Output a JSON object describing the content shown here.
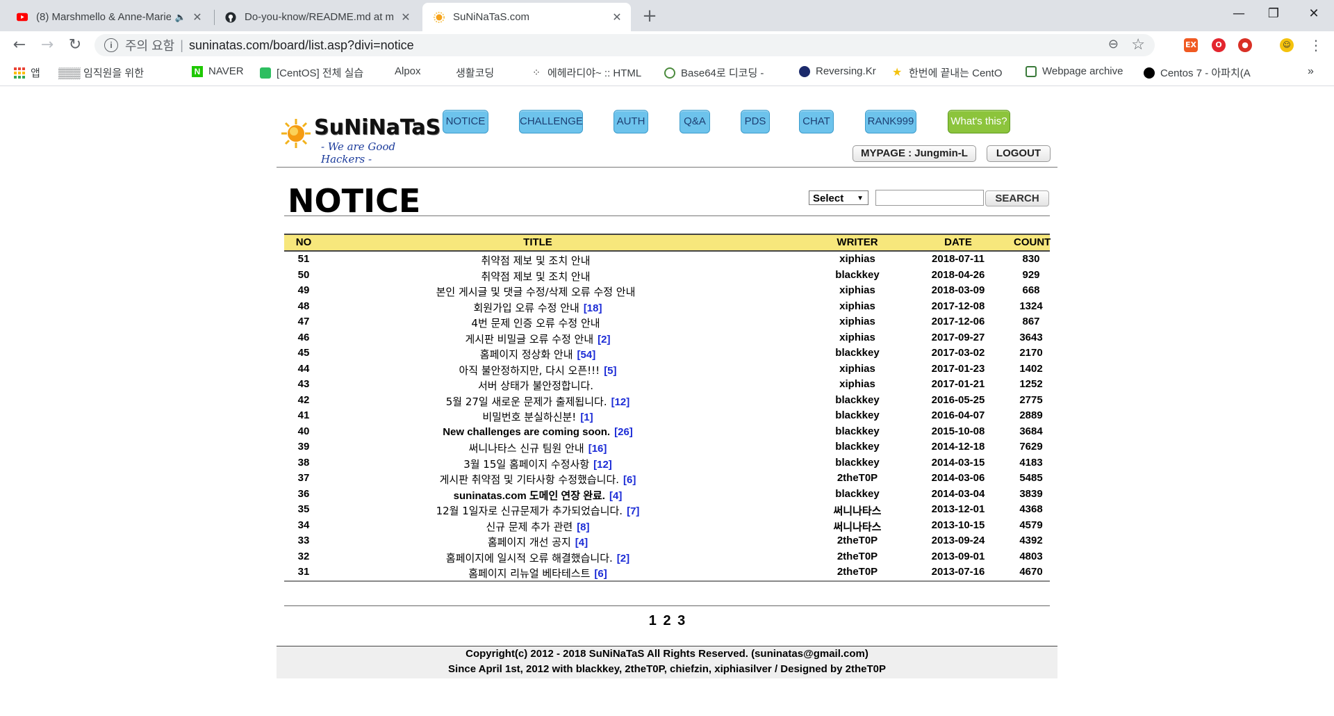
{
  "browser": {
    "tabs": [
      {
        "title": "(8) Marshmello & Anne-Marie",
        "icon": "youtube-icon"
      },
      {
        "title": "Do-you-know/README.md at m",
        "icon": "github-icon"
      },
      {
        "title": "SuNiNaTaS.com",
        "icon": "sun-icon"
      }
    ],
    "address": {
      "warning": "주의 요함",
      "url": "suninatas.com/board/list.asp?divi=notice"
    },
    "bookmarks": [
      {
        "label": "앱",
        "icon": "apps-icon"
      },
      {
        "label": "▒▒▒ 임직원을 위한",
        "icon": "page-icon"
      },
      {
        "label": "NAVER",
        "icon": "naver-icon"
      },
      {
        "label": "[CentOS] 전체 실습",
        "icon": "evernote-icon"
      },
      {
        "label": "Alpox",
        "icon": "page-icon"
      },
      {
        "label": "생활코딩",
        "icon": "page-icon"
      },
      {
        "label": "에헤라디야~ :: HTML",
        "icon": "dots-icon"
      },
      {
        "label": "Base64로 디코딩 -",
        "icon": "base64-icon"
      },
      {
        "label": "Reversing.Kr",
        "icon": "globe-icon"
      },
      {
        "label": "한번에 끝내는 CentO",
        "icon": "star-icon"
      },
      {
        "label": "Webpage archive",
        "icon": "archive-icon"
      },
      {
        "label": "Centos 7 - 아파치(A",
        "icon": "circle-icon"
      }
    ]
  },
  "site": {
    "brand": "SuNiNaTaS",
    "slogan": "- We are Good Hackers -",
    "nav": [
      "NOTICE",
      "CHALLENGE",
      "AUTH",
      "Q&A",
      "PDS",
      "CHAT",
      "RANK999",
      "What's this?"
    ],
    "mypage": "MYPAGE : Jungmin-L",
    "logout": "LOGOUT"
  },
  "board": {
    "title": "NOTICE",
    "search": {
      "select_value": "Select",
      "button": "SEARCH",
      "value": ""
    },
    "columns": [
      "NO",
      "TITLE",
      "WRITER",
      "DATE",
      "COUNT"
    ],
    "rows": [
      {
        "no": "51",
        "title": "취약점 제보 및 조치 안내",
        "comments": "",
        "writer": "xiphias",
        "date": "2018-07-11",
        "count": "830"
      },
      {
        "no": "50",
        "title": "취약점 제보 및 조치 안내",
        "comments": "",
        "writer": "blackkey",
        "date": "2018-04-26",
        "count": "929"
      },
      {
        "no": "49",
        "title": "본인 게시글 및 댓글 수정/삭제 오류 수정 안내",
        "comments": "",
        "writer": "xiphias",
        "date": "2018-03-09",
        "count": "668"
      },
      {
        "no": "48",
        "title": "회원가입 오류 수정 안내",
        "comments": "[18]",
        "writer": "xiphias",
        "date": "2017-12-08",
        "count": "1324"
      },
      {
        "no": "47",
        "title": "4번 문제 인증 오류 수정 안내",
        "comments": "",
        "writer": "xiphias",
        "date": "2017-12-06",
        "count": "867"
      },
      {
        "no": "46",
        "title": "게시판 비밀글 오류 수정 안내",
        "comments": "[2]",
        "writer": "xiphias",
        "date": "2017-09-27",
        "count": "3643"
      },
      {
        "no": "45",
        "title": "홈페이지 정상화 안내",
        "comments": "[54]",
        "writer": "blackkey",
        "date": "2017-03-02",
        "count": "2170"
      },
      {
        "no": "44",
        "title": "아직 불안정하지만, 다시 오픈!!!",
        "comments": "[5]",
        "writer": "xiphias",
        "date": "2017-01-23",
        "count": "1402"
      },
      {
        "no": "43",
        "title": "서버 상태가 불안정합니다.",
        "comments": "",
        "writer": "xiphias",
        "date": "2017-01-21",
        "count": "1252"
      },
      {
        "no": "42",
        "title": "5월 27일 새로운 문제가 출제됩니다.",
        "comments": "[12]",
        "writer": "blackkey",
        "date": "2016-05-25",
        "count": "2775"
      },
      {
        "no": "41",
        "title": "비밀번호 분실하신분!",
        "comments": "[1]",
        "writer": "blackkey",
        "date": "2016-04-07",
        "count": "2889"
      },
      {
        "no": "40",
        "title": "New challenges are coming soon.",
        "comments": "[26]",
        "writer": "blackkey",
        "date": "2015-10-08",
        "count": "3684"
      },
      {
        "no": "39",
        "title": "써니나타스 신규 팀원 안내",
        "comments": "[16]",
        "writer": "blackkey",
        "date": "2014-12-18",
        "count": "7629"
      },
      {
        "no": "38",
        "title": "3월 15일 홈페이지 수정사항",
        "comments": "[12]",
        "writer": "blackkey",
        "date": "2014-03-15",
        "count": "4183"
      },
      {
        "no": "37",
        "title": "게시판 취약점 및 기타사항 수정했습니다.",
        "comments": "[6]",
        "writer": "2theT0P",
        "date": "2014-03-06",
        "count": "5485"
      },
      {
        "no": "36",
        "title": "suninatas.com 도메인 연장 완료.",
        "comments": "[4]",
        "writer": "blackkey",
        "date": "2014-03-04",
        "count": "3839"
      },
      {
        "no": "35",
        "title": "12월 1일자로 신규문제가 추가되었습니다.",
        "comments": "[7]",
        "writer": "써니나타스",
        "date": "2013-12-01",
        "count": "4368"
      },
      {
        "no": "34",
        "title": "신규 문제 추가 관련",
        "comments": "[8]",
        "writer": "써니나타스",
        "date": "2013-10-15",
        "count": "4579"
      },
      {
        "no": "33",
        "title": "홈페이지 개선 공지",
        "comments": "[4]",
        "writer": "2theT0P",
        "date": "2013-09-24",
        "count": "4392"
      },
      {
        "no": "32",
        "title": "홈페이지에 일시적 오류 해결했습니다.",
        "comments": "[2]",
        "writer": "2theT0P",
        "date": "2013-09-01",
        "count": "4803"
      },
      {
        "no": "31",
        "title": "홈페이지 리뉴얼 베타테스트",
        "comments": "[6]",
        "writer": "2theT0P",
        "date": "2013-07-16",
        "count": "4670"
      }
    ],
    "pages": [
      "1",
      "2",
      "3"
    ]
  },
  "footer": {
    "line1": "Copyright(c) 2012 - 2018 SuNiNaTaS All Rights Reserved. (suninatas@gmail.com)",
    "line2": "Since April 1st, 2012 with blackkey, 2theT0P, chiefzin, xiphiasilver / Designed by 2theT0P"
  }
}
